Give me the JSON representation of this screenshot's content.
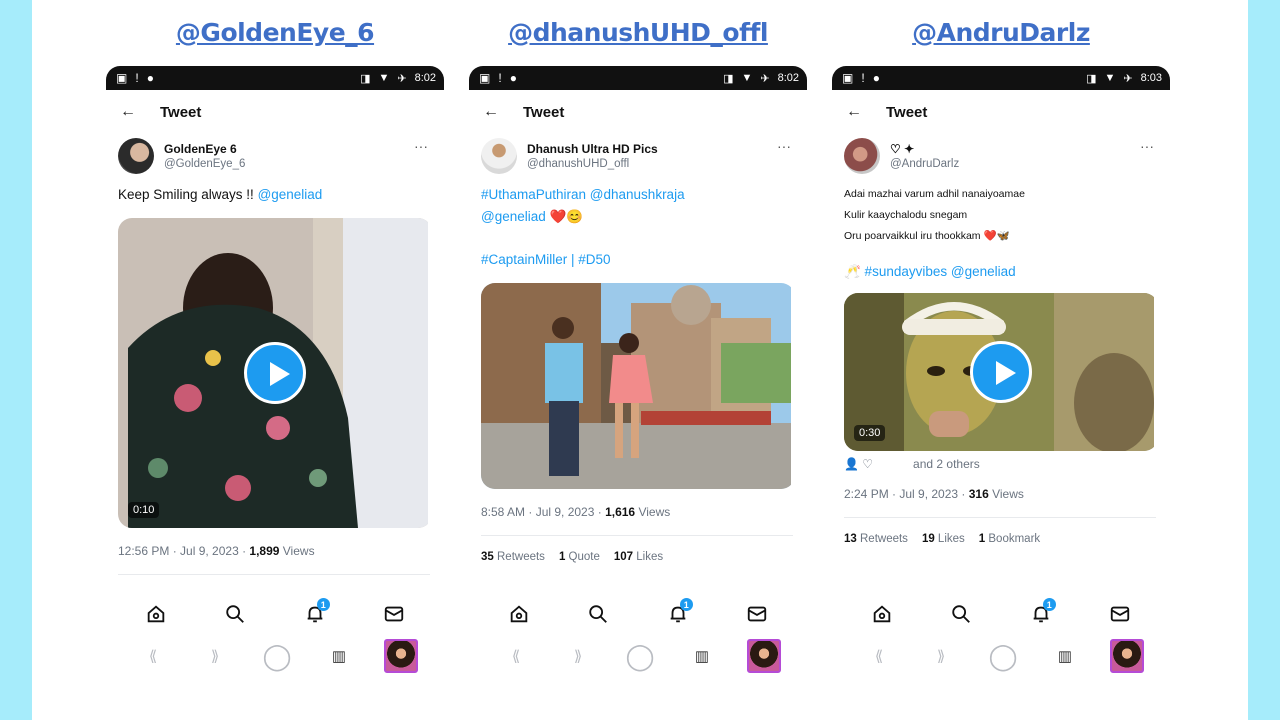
{
  "columns": [
    {
      "handle": "@GoldenEye_6",
      "status_time": "8:02",
      "header_title": "Tweet",
      "display_name": "GoldenEye 6",
      "username": "@GoldenEye_6",
      "text": "Keep Smiling always !! ",
      "mention": "@geneliad",
      "video_duration": "0:10",
      "timestamp": "12:56 PM · Jul 9, 2023 · ",
      "views": "1,899",
      "views_label": " Views",
      "notif_count": "1"
    },
    {
      "handle": "@dhanushUHD_offl",
      "status_time": "8:02",
      "header_title": "Tweet",
      "display_name": "Dhanush Ultra HD Pics",
      "username": "@dhanushUHD_offl",
      "line1": "#UthamaPuthiran @dhanushkraja",
      "line2": "@geneliad ❤️😊",
      "line3": "#CaptainMiller | #D50",
      "timestamp": "8:58 AM · Jul 9, 2023 · ",
      "views": "1,616",
      "views_label": " Views",
      "retweets": "35",
      "retweets_label": " Retweets",
      "quotes": "1",
      "quotes_label": " Quote",
      "likes": "107",
      "likes_label": " Likes",
      "notif_count": "1"
    },
    {
      "handle": "@AndruDarlz",
      "status_time": "8:03",
      "header_title": "Tweet",
      "display_name": "♡ ✦",
      "username": "@AndruDarlz",
      "line1": "Adai mazhai varum adhil nanaiyoamae",
      "line2": "Kulir kaaychalodu snegam",
      "line3": "Oru poarvaikkul iru thookkam ❤️🦋",
      "line4": "🥂 #sundayvibes @geneliad",
      "video_duration": "0:30",
      "likers": "👤 ♡",
      "likers_others": "and 2 others",
      "timestamp": "2:24 PM · Jul 9, 2023 · ",
      "views": "316",
      "views_label": " Views",
      "retweets": "13",
      "retweets_label": " Retweets",
      "likes": "19",
      "likes_label": " Likes",
      "bookmarks": "1",
      "bookmarks_label": " Bookmark",
      "notif_count": "1"
    }
  ]
}
